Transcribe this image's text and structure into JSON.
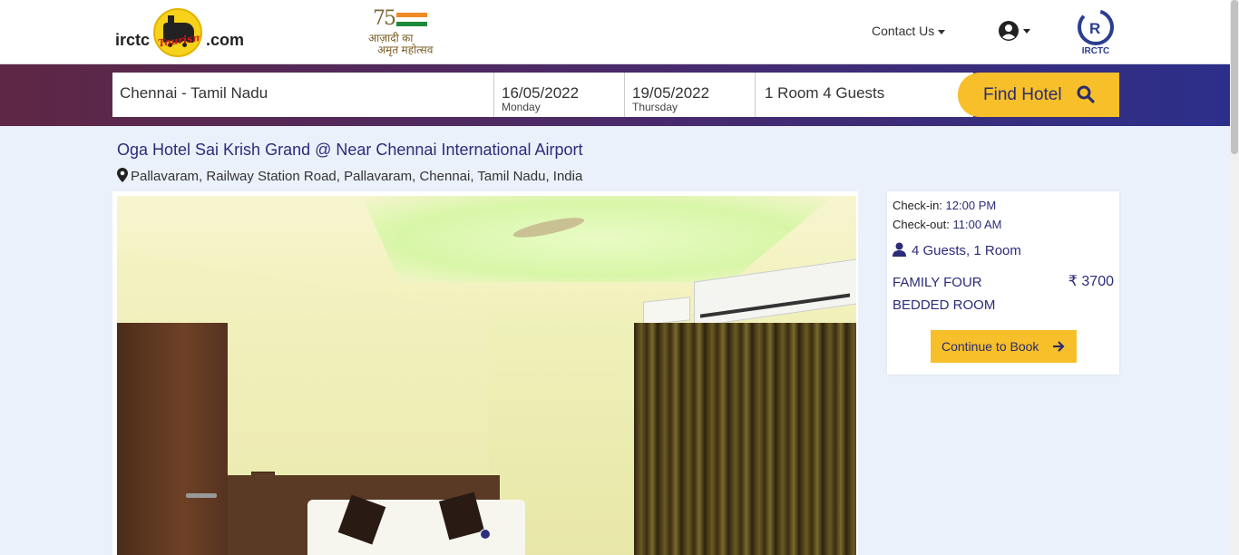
{
  "header": {
    "logo_left": "irctc",
    "logo_script": "Tourism",
    "logo_right": ".com",
    "azadi_num": "75",
    "azadi_line1": "आज़ादी का",
    "azadi_line2": "अमृत महोत्सव",
    "contact_label": "Contact Us",
    "user_icon": "user-circle-icon",
    "irctc_label": "IRCTC"
  },
  "search": {
    "location": "Chennai - Tamil Nadu",
    "checkin_date": "16/05/2022",
    "checkin_day": "Monday",
    "checkout_date": "19/05/2022",
    "checkout_day": "Thursday",
    "rooms_guests": "1 Room 4 Guests",
    "find_button": "Find Hotel"
  },
  "hotel": {
    "name": "Oga Hotel Sai Krish Grand @ Near Chennai International Airport",
    "address": "Pallavaram, Railway Station Road, Pallavaram, Chennai, Tamil Nadu, India"
  },
  "booking": {
    "checkin_label": "Check-in:",
    "checkin_time": "12:00 PM",
    "checkout_label": "Check-out:",
    "checkout_time": "11:00 AM",
    "guests_rooms": "4 Guests, 1 Room",
    "room_name": "FAMILY FOUR BEDDED ROOM",
    "price": "₹ 3700",
    "continue_button": "Continue to Book"
  },
  "colors": {
    "accent": "#f7bf2a",
    "brand": "#2c2c7a",
    "band_start": "#5e2744",
    "band_end": "#2c2f8a",
    "background": "#eaf1fb"
  }
}
